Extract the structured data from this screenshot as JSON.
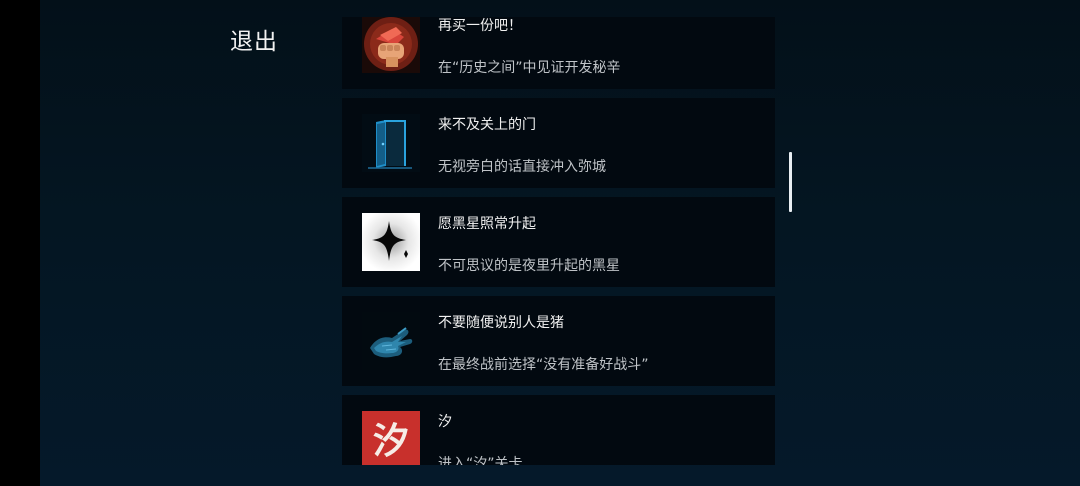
{
  "header": {
    "exit_label": "退出"
  },
  "achievements": [
    {
      "title": "再买一份吧！",
      "description": "在“历史之间”中见证开发秘辛",
      "icon": "fist-money-icon"
    },
    {
      "title": "来不及关上的门",
      "description": "无视旁白的话直接冲入弥城",
      "icon": "open-door-icon"
    },
    {
      "title": "愿黑星照常升起",
      "description": "不可思议的是夜里升起的黑星",
      "icon": "black-star-icon"
    },
    {
      "title": "不要随便说别人是猪",
      "description": "在最终战前选择“没有准备好战斗”",
      "icon": "blue-hand-icon"
    },
    {
      "title": "汐",
      "description": "进入“汐”关卡",
      "icon": "xi-character-icon",
      "icon_text": "汐"
    }
  ],
  "colors": {
    "background": "#041622",
    "card": "#020910",
    "title_text": "#f0f0f0",
    "description_text": "#bfc3c7",
    "xi_icon_red": "#c8302c"
  }
}
